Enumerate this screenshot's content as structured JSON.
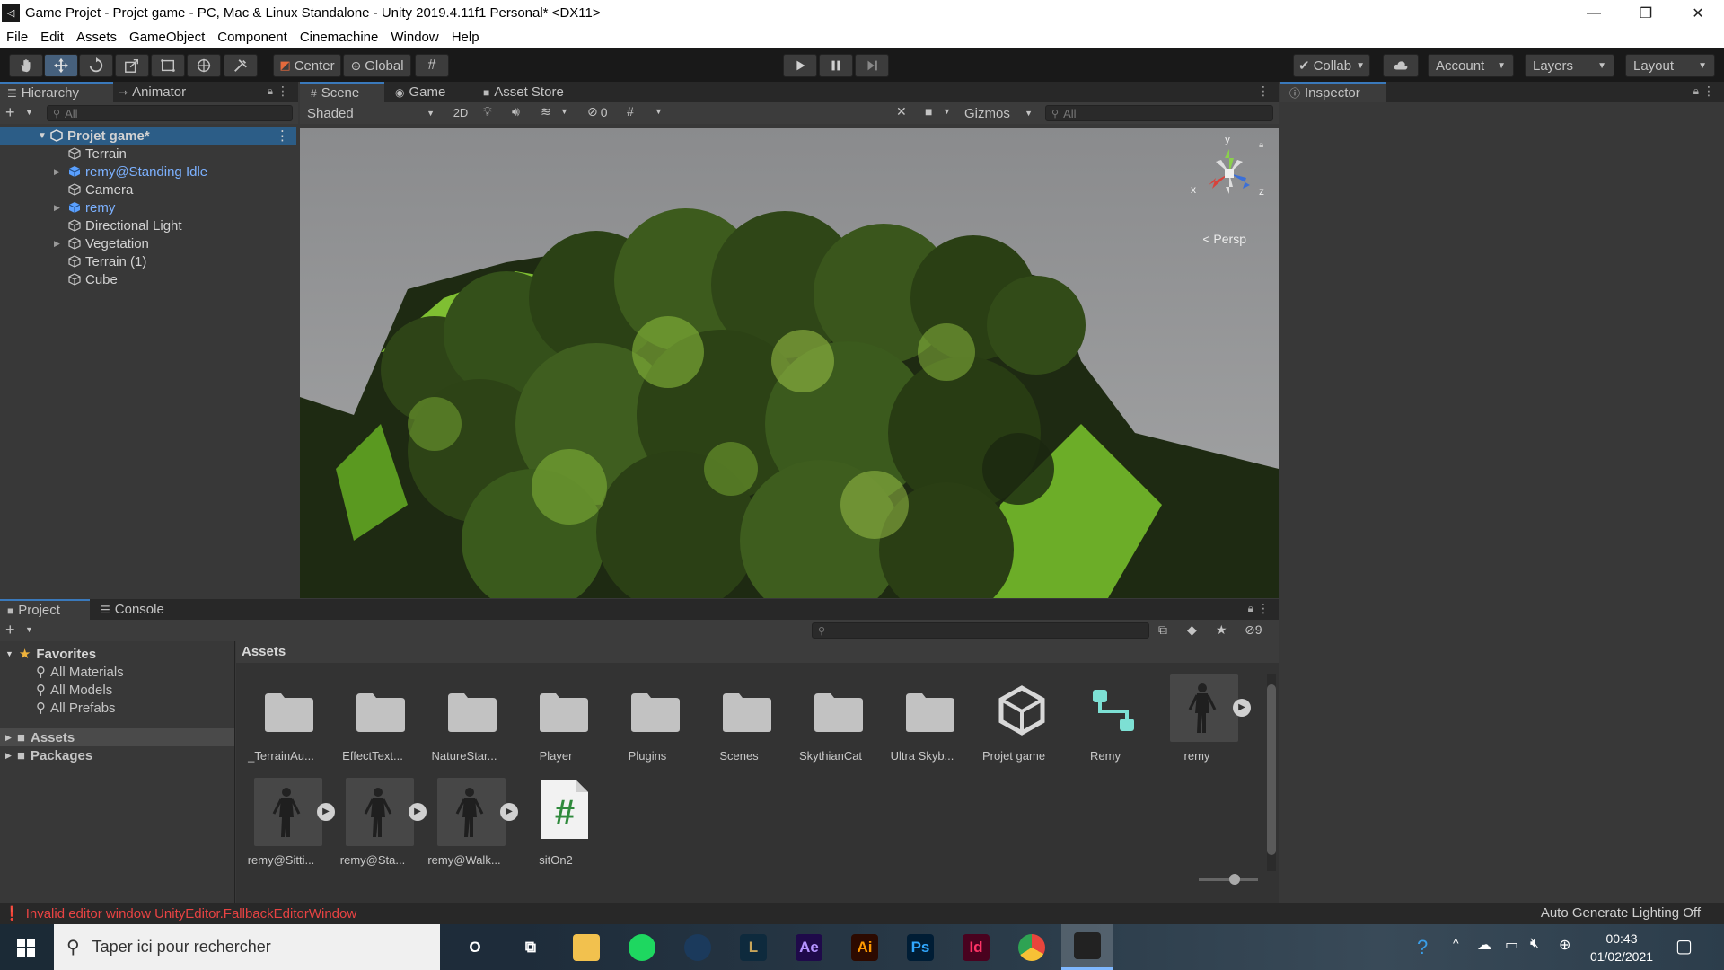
{
  "window": {
    "title": "Game Projet - Projet game - PC, Mac & Linux Standalone - Unity 2019.4.11f1 Personal* <DX11>",
    "controls": {
      "minimize": "—",
      "maximize": "❐",
      "close": "✕"
    }
  },
  "menu": [
    "File",
    "Edit",
    "Assets",
    "GameObject",
    "Component",
    "Cinemachine",
    "Window",
    "Help"
  ],
  "toolbar": {
    "pivot_label": "Center",
    "space_label": "Global",
    "collab_label": "Collab",
    "account_label": "Account",
    "layers_label": "Layers",
    "layout_label": "Layout"
  },
  "hierarchy": {
    "tabs": [
      "Hierarchy",
      "Animator"
    ],
    "search_placeholder": "All",
    "scene_name": "Projet game*",
    "items": [
      {
        "label": "Terrain",
        "prefab": false,
        "expandable": false
      },
      {
        "label": "remy@Standing Idle",
        "prefab": true,
        "expandable": true
      },
      {
        "label": "Camera",
        "prefab": false,
        "expandable": false
      },
      {
        "label": "remy",
        "prefab": true,
        "expandable": true
      },
      {
        "label": "Directional Light",
        "prefab": false,
        "expandable": false
      },
      {
        "label": "Vegetation",
        "prefab": false,
        "expandable": true
      },
      {
        "label": "Terrain (1)",
        "prefab": false,
        "expandable": false
      },
      {
        "label": "Cube",
        "prefab": false,
        "expandable": false
      }
    ]
  },
  "scene": {
    "tabs": [
      "Scene",
      "Game",
      "Asset Store"
    ],
    "shading_mode": "Shaded",
    "mode_2d": "2D",
    "hidden_count": "0",
    "gizmos_label": "Gizmos",
    "search_placeholder": "All",
    "projection_label": "Persp",
    "axis": {
      "x": "x",
      "y": "y",
      "z": "z"
    }
  },
  "inspector": {
    "tab": "Inspector"
  },
  "project": {
    "tabs": [
      "Project",
      "Console"
    ],
    "hidden_count": "9",
    "favorites": {
      "label": "Favorites",
      "items": [
        "All Materials",
        "All Models",
        "All Prefabs"
      ]
    },
    "roots": [
      "Assets",
      "Packages"
    ],
    "breadcrumb": "Assets",
    "assets": [
      {
        "label": "_TerrainAu...",
        "kind": "folder"
      },
      {
        "label": "EffectText...",
        "kind": "folder"
      },
      {
        "label": "NatureStar...",
        "kind": "folder"
      },
      {
        "label": "Player",
        "kind": "folder"
      },
      {
        "label": "Plugins",
        "kind": "folder"
      },
      {
        "label": "Scenes",
        "kind": "folder"
      },
      {
        "label": "SkythianCat",
        "kind": "folder"
      },
      {
        "label": "Ultra Skyb...",
        "kind": "folder"
      },
      {
        "label": "Projet game",
        "kind": "unity-scene"
      },
      {
        "label": "Remy",
        "kind": "animator-controller"
      },
      {
        "label": "remy",
        "kind": "model"
      },
      {
        "label": "remy@Sitti...",
        "kind": "model"
      },
      {
        "label": "remy@Sta...",
        "kind": "model"
      },
      {
        "label": "remy@Walk...",
        "kind": "model"
      },
      {
        "label": "sitOn2",
        "kind": "script"
      }
    ]
  },
  "status": {
    "error_message": "Invalid editor window UnityEditor.FallbackEditorWindow",
    "lighting": "Auto Generate Lighting Off"
  },
  "taskbar": {
    "search_placeholder": "Taper ici pour rechercher",
    "time": "00:43",
    "date": "01/02/2021",
    "apps": [
      {
        "name": "cortana-icon",
        "label": "O"
      },
      {
        "name": "task-view-icon",
        "label": "⧉"
      },
      {
        "name": "file-explorer-icon",
        "label": ""
      },
      {
        "name": "spotify-icon",
        "label": ""
      },
      {
        "name": "steam-icon",
        "label": ""
      },
      {
        "name": "league-icon",
        "label": "L"
      },
      {
        "name": "after-effects-icon",
        "label": "Ae"
      },
      {
        "name": "illustrator-icon",
        "label": "Ai"
      },
      {
        "name": "photoshop-icon",
        "label": "Ps"
      },
      {
        "name": "indesign-icon",
        "label": "Id"
      },
      {
        "name": "chrome-icon",
        "label": ""
      },
      {
        "name": "unity-icon",
        "label": ""
      }
    ]
  },
  "colors": {
    "accent_blue": "#3a79bb",
    "prefab_blue": "#7cb1ff",
    "error_red": "#e84343",
    "panel_bg": "#383838",
    "toolbar_bg": "#191919"
  }
}
